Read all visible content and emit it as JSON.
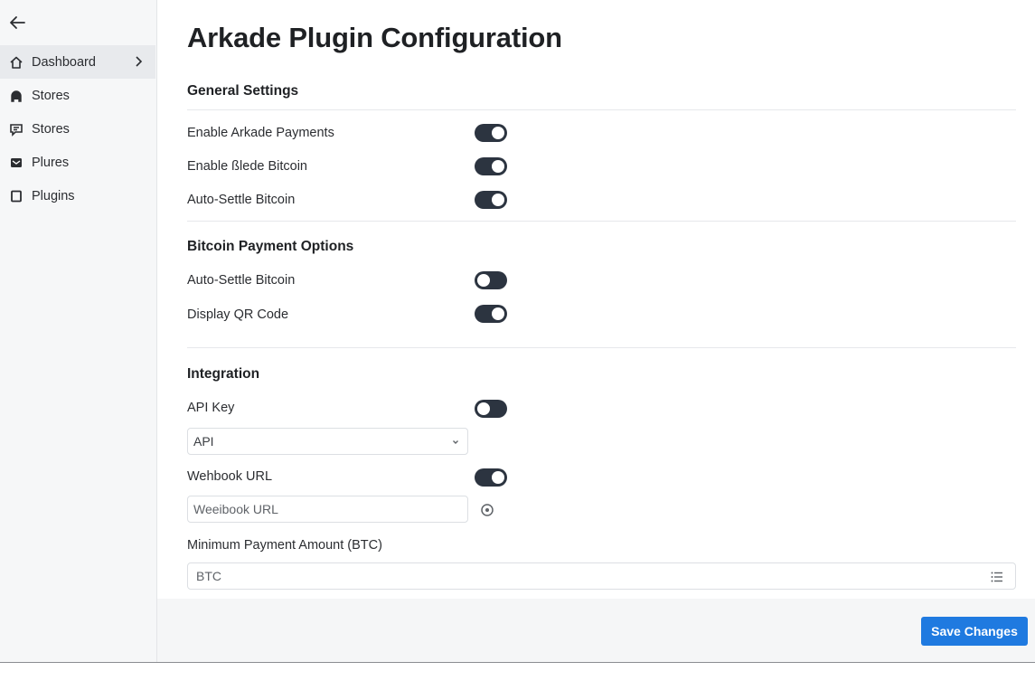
{
  "sidebar": {
    "back_icon": "arrow-left-icon",
    "items": [
      {
        "label": "Dashboard",
        "icon": "home-icon",
        "active": true
      },
      {
        "label": "Stores",
        "icon": "headset-icon"
      },
      {
        "label": "Stores",
        "icon": "chat-icon"
      },
      {
        "label": "Plures",
        "icon": "inbox-icon"
      },
      {
        "label": "Plugins",
        "icon": "square-icon"
      }
    ]
  },
  "page": {
    "title": "Arkade Plugin Configuration"
  },
  "general": {
    "title": "General Settings",
    "enable_payments": {
      "label": "Enable Arkade Payments",
      "on": true
    },
    "enable_blade": {
      "label": "Enable ßlede Bitcoin",
      "on": true
    },
    "auto_settle": {
      "label": "Auto-Settle Bitcoin",
      "on": true
    }
  },
  "bitcoin": {
    "title": "Bitcoin Payment Options",
    "auto_settle": {
      "label": "Auto-Settle Bitcoin",
      "on": false
    },
    "display_qr": {
      "label": "Display QR Code",
      "on": true
    }
  },
  "integration": {
    "title": "Integration",
    "api_key": {
      "label": "API Key",
      "on": false,
      "select_value": "API"
    },
    "webhook": {
      "label": "Wehbook URL",
      "on": true,
      "placeholder": "Weeibook URL"
    },
    "min_amount": {
      "label": "Minimum Payment Amount (BTC)",
      "placeholder": "BTC"
    }
  },
  "footer": {
    "save_label": "Save Changes"
  },
  "colors": {
    "accent": "#1f7ae0",
    "toggle": "#2c3440"
  }
}
